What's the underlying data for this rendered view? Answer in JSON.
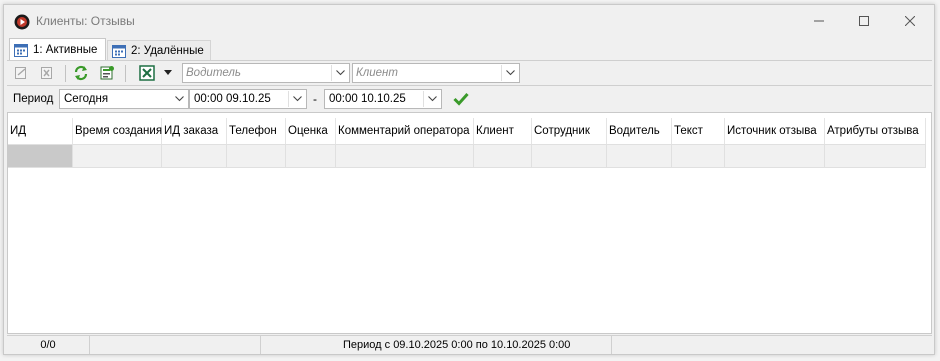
{
  "window": {
    "title": "Клиенты: Отзывы"
  },
  "tabs": [
    {
      "label": "1: Активные",
      "active": true
    },
    {
      "label": "2: Удалённые",
      "active": false
    }
  ],
  "toolbar": {
    "icons": [
      "edit-icon",
      "delete-icon",
      "refresh-icon",
      "properties-icon",
      "excel-export-icon"
    ],
    "driver_placeholder": "Водитель",
    "client_placeholder": "Клиент"
  },
  "period": {
    "label": "Период",
    "preset": "Сегодня",
    "from": "00:00 09.10.25",
    "separator": "-",
    "to": "00:00 10.10.25"
  },
  "table": {
    "columns": [
      "ИД",
      "Время создания",
      "ИД заказа",
      "Телефон",
      "Оценка",
      "Комментарий оператора",
      "Клиент",
      "Сотрудник",
      "Водитель",
      "Текст",
      "Источник отзыва",
      "Атрибуты отзыва"
    ],
    "rows": []
  },
  "status": {
    "count": "0/0",
    "period_text": "Период с 09.10.2025 0:00 по 10.10.2025 0:00"
  },
  "colors": {
    "accent_green": "#3a9a2a",
    "excel_green": "#1d6f42",
    "app_icon_red": "#c0392b"
  }
}
